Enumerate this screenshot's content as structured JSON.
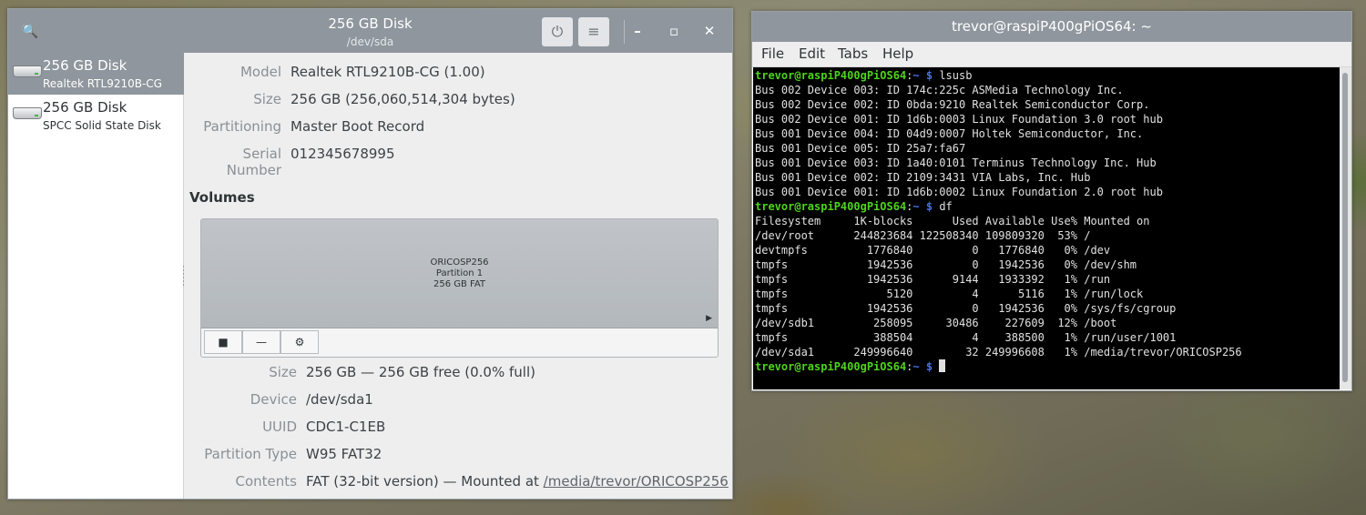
{
  "disks_window": {
    "title": "256 GB Disk",
    "subtitle": "/dev/sda",
    "power_glyph": "⏻",
    "menu_glyph": "≡",
    "minimize_glyph": "–",
    "maximize_glyph": "▫",
    "close_glyph": "✕",
    "search_glyph": "🔍"
  },
  "sidebar": {
    "disks": [
      {
        "name": "256 GB Disk",
        "subtitle": "Realtek RTL9210B-CG"
      },
      {
        "name": "256 GB Disk",
        "subtitle": "SPCC Solid State Disk"
      }
    ]
  },
  "disk_props": {
    "model_label": "Model",
    "model_value": "Realtek RTL9210B-CG (1.00)",
    "size_label": "Size",
    "size_value": "256 GB (256,060,514,304 bytes)",
    "partitioning_label": "Partitioning",
    "partitioning_value": "Master Boot Record",
    "serial_label": "Serial Number",
    "serial_value": "012345678995"
  },
  "volumes": {
    "heading": "Volumes",
    "partition": {
      "line1": "ORICOSP256",
      "line2": "Partition 1",
      "line3": "256 GB FAT"
    },
    "arrow_glyph": "▶",
    "stop_glyph": "■",
    "minus_glyph": "—",
    "gear_glyph": "⚙"
  },
  "volume_props": {
    "size_label": "Size",
    "size_value": "256 GB — 256 GB free (0.0% full)",
    "device_label": "Device",
    "device_value": "/dev/sda1",
    "uuid_label": "UUID",
    "uuid_value": "CDC1-C1EB",
    "ptype_label": "Partition Type",
    "ptype_value": "W95 FAT32",
    "contents_label": "Contents",
    "contents_prefix": "FAT (32-bit version) — Mounted at ",
    "contents_link": "/media/trevor/ORICOSP256"
  },
  "terminal": {
    "title": "trevor@raspiP400gPiOS64: ~",
    "menu": [
      "File",
      "Edit",
      "Tabs",
      "Help"
    ],
    "prompt_user": "trevor@raspiP400gPiOS64",
    "prompt_colon": ":",
    "prompt_path": "~",
    "prompt_dollar": " $",
    "cmd1": " lsusb",
    "lsusb_output": [
      "Bus 002 Device 003: ID 174c:225c ASMedia Technology Inc.",
      "Bus 002 Device 002: ID 0bda:9210 Realtek Semiconductor Corp.",
      "Bus 002 Device 001: ID 1d6b:0003 Linux Foundation 3.0 root hub",
      "Bus 001 Device 004: ID 04d9:0007 Holtek Semiconductor, Inc.",
      "Bus 001 Device 005: ID 25a7:fa67",
      "Bus 001 Device 003: ID 1a40:0101 Terminus Technology Inc. Hub",
      "Bus 001 Device 002: ID 2109:3431 VIA Labs, Inc. Hub",
      "Bus 001 Device 001: ID 1d6b:0002 Linux Foundation 2.0 root hub"
    ],
    "cmd2": " df",
    "df_output": [
      "Filesystem     1K-blocks      Used Available Use% Mounted on",
      "/dev/root      244823684 122508340 109809320  53% /",
      "devtmpfs         1776840         0   1776840   0% /dev",
      "tmpfs            1942536         0   1942536   0% /dev/shm",
      "tmpfs            1942536      9144   1933392   1% /run",
      "tmpfs               5120         4      5116   1% /run/lock",
      "tmpfs            1942536         0   1942536   0% /sys/fs/cgroup",
      "/dev/sdb1         258095     30486    227609  12% /boot",
      "tmpfs             388504         4    388500   1% /run/user/1001",
      "/dev/sda1      249996640        32 249996608   1% /media/trevor/ORICOSP256"
    ]
  }
}
